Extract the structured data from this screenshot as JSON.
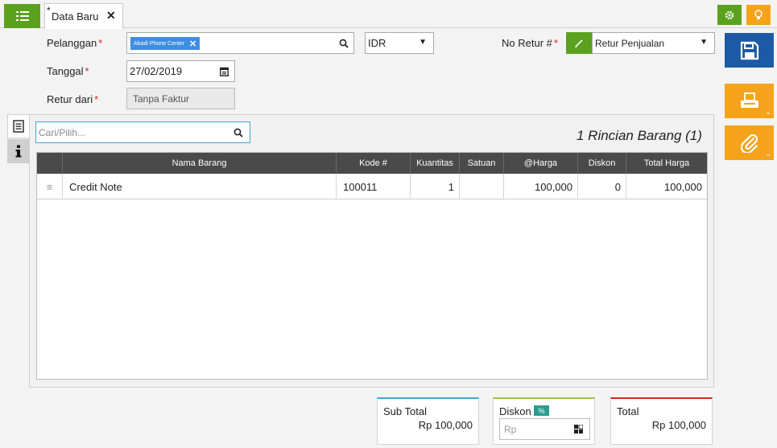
{
  "tab": {
    "modified_marker": "*",
    "label": "Data Baru"
  },
  "form": {
    "customer_label": "Pelanggan",
    "customer_tag": "Abadi Phone Center",
    "currency_value": "IDR",
    "return_no_label": "No Retur #",
    "return_type_value": "Retur Penjualan",
    "date_label": "Tanggal",
    "date_value": "27/02/2019",
    "return_from_label": "Retur dari",
    "return_from_value": "Tanpa Faktur",
    "required_mark": "*"
  },
  "detail": {
    "search_placeholder": "Cari/Pilih...",
    "count_label": "1 Rincian Barang (1)",
    "columns": [
      "Nama Barang",
      "Kode #",
      "Kuantitas",
      "Satuan",
      "@Harga",
      "Diskon",
      "Total Harga"
    ],
    "rows": [
      {
        "name": "Credit Note",
        "code": "100011",
        "qty": "1",
        "unit": "",
        "price": "100,000",
        "discount": "0",
        "total": "100,000"
      }
    ]
  },
  "summary": {
    "subtotal_label": "Sub Total",
    "subtotal_value": "Rp 100,000",
    "discount_label": "Diskon",
    "discount_badge": "%",
    "discount_placeholder": "Rp",
    "total_label": "Total",
    "total_value": "Rp 100,000"
  },
  "colors": {
    "green": "#5aa21e",
    "orange": "#f5a31a",
    "blue": "#1c5aa6",
    "tag_blue": "#3e8ee0",
    "teal": "#2a9d8f",
    "subtotal_accent": "#3ea7cf",
    "discount_accent": "#9cc732",
    "total_accent": "#d9261c"
  },
  "icons": {
    "menu": "list-icon",
    "close": "close-icon",
    "gear": "gear-icon",
    "bulb": "lightbulb-icon",
    "save": "floppy-disk-icon",
    "print": "printer-icon",
    "attach": "paperclip-icon",
    "search": "search-icon",
    "calendar": "calendar-icon",
    "pencil": "pencil-icon",
    "detail_tab": "document-icon",
    "info_tab": "info-icon",
    "drag": "drag-handle-icon",
    "calculator": "calculator-icon"
  }
}
